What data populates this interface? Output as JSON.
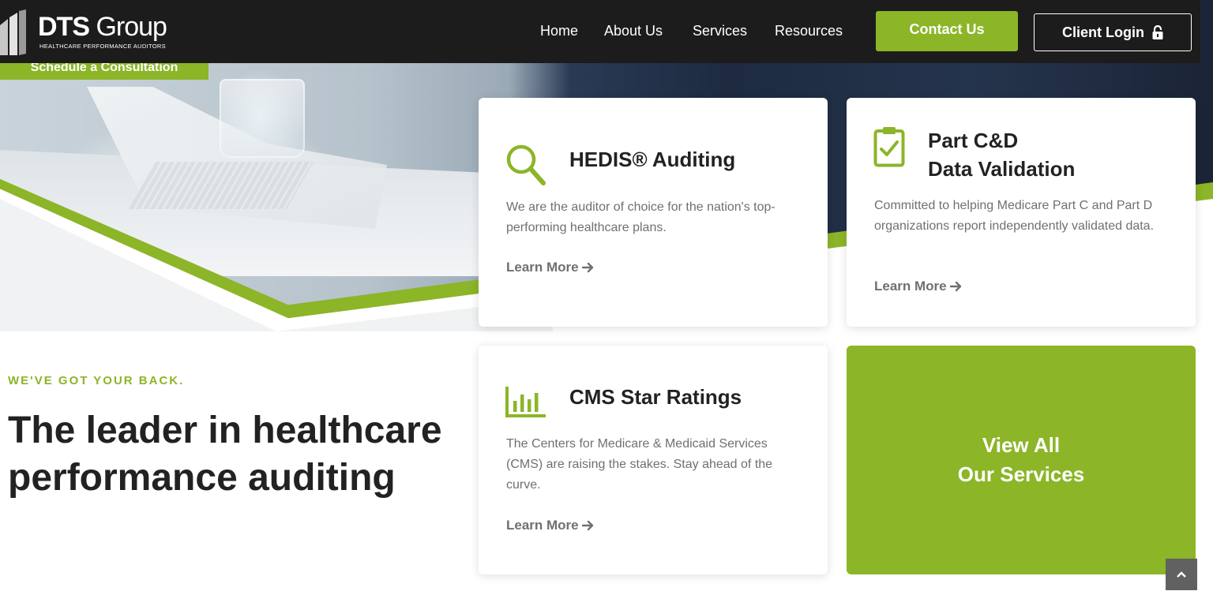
{
  "header": {
    "logo": {
      "name_bold": "DTS",
      "name_regular": "Group",
      "tagline": "HEALTHCARE PERFORMANCE AUDITORS"
    },
    "nav": [
      {
        "label": "Home"
      },
      {
        "label": "About Us"
      },
      {
        "label": "Services"
      },
      {
        "label": "Resources"
      }
    ],
    "contact_label": "Contact Us",
    "login_label": "Client Login"
  },
  "hero": {
    "schedule_label": "Schedule a Consultation"
  },
  "intro": {
    "eyebrow": "WE'VE GOT YOUR BACK.",
    "headline": "The leader in healthcare performance auditing"
  },
  "cards": [
    {
      "icon": "magnifier-icon",
      "title": "HEDIS® Auditing",
      "description": "We are the auditor of choice for the nation's top-performing healthcare plans.",
      "link": "Learn More"
    },
    {
      "icon": "clipboard-check-icon",
      "title_line1": "Part C&D",
      "title_line2": "Data Validation",
      "description": "Committed to helping Medicare Part C and Part D organizations report independently validated data.",
      "link": "Learn More"
    },
    {
      "icon": "bar-chart-icon",
      "title": "CMS Star Ratings",
      "description": "The Centers for Medicare & Medicaid Services (CMS) are raising the stakes. Stay ahead of the curve.",
      "link": "Learn More"
    }
  ],
  "view_all": {
    "line1": "View All",
    "line2": "Our Services"
  },
  "colors": {
    "accent": "#8cb528",
    "header_bg": "#1c1c1c",
    "heading": "#222222",
    "body_text": "#707070"
  },
  "scroll_top_icon": "chevron-up-icon"
}
